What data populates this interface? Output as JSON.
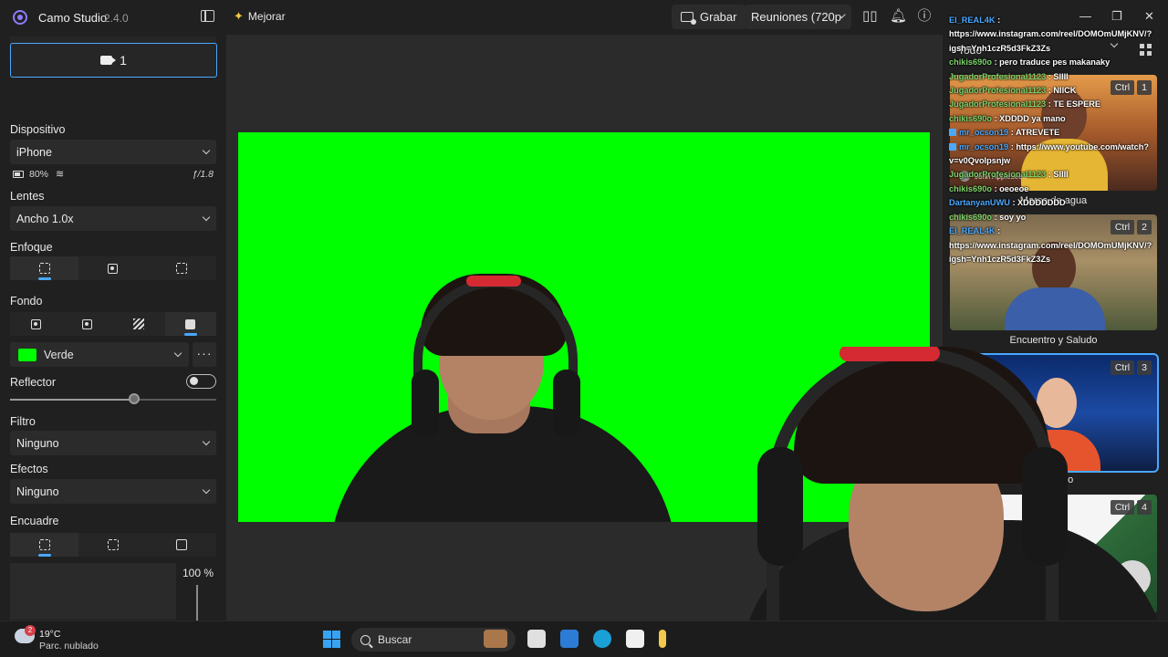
{
  "titlebar": {
    "app_name": "Camo Studio",
    "version": "2.4.0",
    "enhance_label": "Mejorar",
    "record_label": "Grabar",
    "meetings_label": "Reuniones (720p"
  },
  "sidebar": {
    "camera_button_label": "1",
    "device": {
      "label": "Dispositivo",
      "value": "iPhone",
      "battery": "80%",
      "aperture": "ƒ/1.8"
    },
    "lens": {
      "label": "Lentes",
      "value": "Ancho 1.0x"
    },
    "focus": {
      "label": "Enfoque"
    },
    "background": {
      "label": "Fondo",
      "color_name": "Verde",
      "color": "#00ff00"
    },
    "spotlight": {
      "label": "Reflector",
      "level": 0.6
    },
    "filter": {
      "label": "Filtro",
      "value": "Ninguno"
    },
    "effects": {
      "label": "Efectos",
      "value": "Ninguno"
    },
    "framing": {
      "label": "Encuadre",
      "zoom": "100 %"
    }
  },
  "scenes": {
    "header": "Todo",
    "items": [
      {
        "ctrl": "Ctrl",
        "num": "1",
        "caption": "Marca de agua",
        "name_tag": "John Appleseed"
      },
      {
        "ctrl": "Ctrl",
        "num": "2",
        "caption": "Encuentro y Saludo"
      },
      {
        "ctrl": "Ctrl",
        "num": "3",
        "caption": "blanco"
      },
      {
        "ctrl": "Ctrl",
        "num": "4",
        "caption": ""
      }
    ]
  },
  "chat": [
    {
      "user": "El_REAL4K",
      "msg": ":",
      "color": "#4aa8ff"
    },
    {
      "user": "",
      "msg": "https://www.instagram.com/reel/DOMOmUMjKNV/?igsh=Ynh1czR5d3FkZ3Zs",
      "color": "#ffffff"
    },
    {
      "user": "chikis690o",
      "msg": ": pero traduce pes makanaky",
      "color": "#7cd36b"
    },
    {
      "user": "JugadorProfesional1123",
      "msg": ": SIIII",
      "color": "#7cd36b"
    },
    {
      "user": "JugadorProfesional1123",
      "msg": ": NIICK",
      "color": "#7cd36b"
    },
    {
      "user": "JugadorProfesional1123",
      "msg": ": TE ESPERE",
      "color": "#7cd36b"
    },
    {
      "user": "chikis690o",
      "msg": ": XDDDD ya mano",
      "color": "#7cd36b"
    },
    {
      "user": "mr_ocson19",
      "msg": ": ATREVETE",
      "color": "#4aa8ff",
      "yt": true
    },
    {
      "user": "mr_ocson19",
      "msg": ": https://www.youtube.com/watch?v=v0Qvolpsnjw",
      "color": "#4aa8ff",
      "yt": true
    },
    {
      "user": "JugadorProfesional1123",
      "msg": ": SIIII",
      "color": "#7cd36b"
    },
    {
      "user": "chikis690o",
      "msg": ": oeoeoe",
      "color": "#7cd36b"
    },
    {
      "user": "DartanyanUWU",
      "msg": ": XDDDDDDD",
      "color": "#4aa8ff"
    },
    {
      "user": "chikis690o",
      "msg": ": soy yo",
      "color": "#7cd36b"
    },
    {
      "user": "El_REAL4K",
      "msg": ":",
      "color": "#4aa8ff"
    },
    {
      "user": "",
      "msg": "https://www.instagram.com/reel/DOMOmUMjKNV/?igsh=Ynh1czR5d3FkZ3Zs",
      "color": "#ffffff"
    }
  ],
  "taskbar": {
    "weather_badge": "2",
    "temperature": "19°C",
    "weather_desc": "Parc. nublado",
    "search_label": "Buscar"
  },
  "colors": {
    "accent": "#4aa8ff",
    "chroma": "#00ff00"
  }
}
